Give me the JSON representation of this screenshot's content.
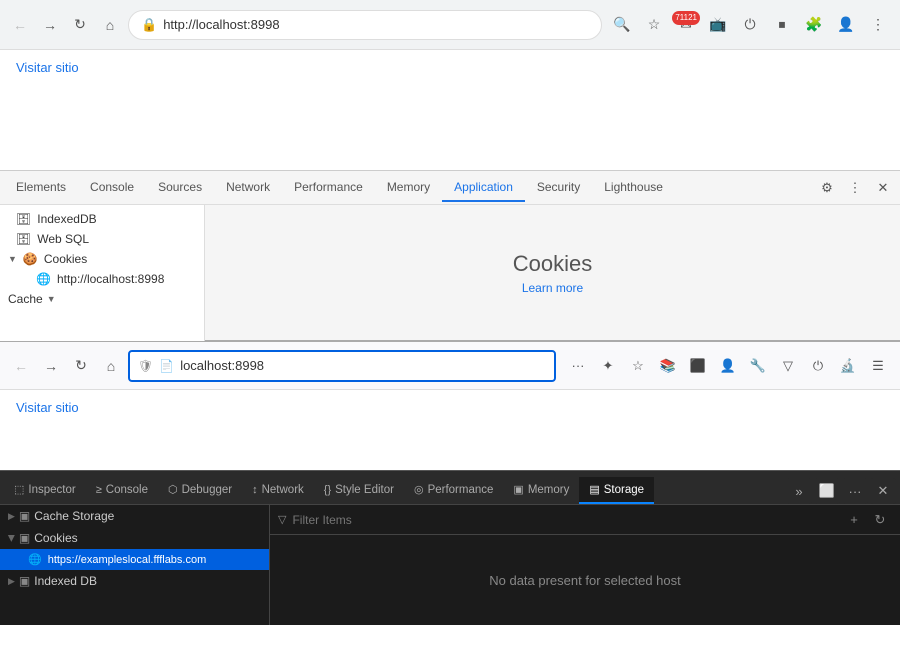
{
  "chrome": {
    "address": "http://localhost:8998",
    "visit_link": "Visitar sitio",
    "nav": {
      "back_label": "←",
      "forward_label": "→",
      "reload_label": "↻",
      "home_label": "⌂"
    },
    "badge_count": "71121",
    "devtools": {
      "tabs": [
        {
          "label": "Elements",
          "active": false
        },
        {
          "label": "Console",
          "active": false
        },
        {
          "label": "Sources",
          "active": false
        },
        {
          "label": "Network",
          "active": false
        },
        {
          "label": "Performance",
          "active": false
        },
        {
          "label": "Memory",
          "active": false
        },
        {
          "label": "Application",
          "active": true
        },
        {
          "label": "Security",
          "active": false
        },
        {
          "label": "Lighthouse",
          "active": false
        }
      ],
      "sidebar_items": [
        {
          "label": "IndexedDB",
          "icon": "🗄",
          "indent": 1
        },
        {
          "label": "Web SQL",
          "icon": "🗄",
          "indent": 1
        },
        {
          "label": "Cookies",
          "icon": "🍪",
          "indent": 0,
          "expanded": true
        },
        {
          "label": "http://localhost:8998",
          "icon": "🌐",
          "indent": 2
        }
      ],
      "cache_label": "Cache",
      "cookies_title": "Cookies",
      "cookies_learn": "Learn more"
    }
  },
  "firefox": {
    "address": "localhost:8998",
    "visit_link": "Visitar sitio",
    "nav": {
      "back_label": "←",
      "forward_label": "→",
      "reload_label": "↻",
      "home_label": "⌂"
    },
    "devtools": {
      "tabs": [
        {
          "label": "Inspector",
          "icon": "⬚",
          "active": false
        },
        {
          "label": "Console",
          "icon": "≥",
          "active": false
        },
        {
          "label": "Debugger",
          "icon": "⬡",
          "active": false
        },
        {
          "label": "Network",
          "icon": "↕",
          "active": false
        },
        {
          "label": "Style Editor",
          "icon": "{}",
          "active": false
        },
        {
          "label": "Performance",
          "icon": "◎",
          "active": false
        },
        {
          "label": "Memory",
          "icon": "▣",
          "active": false
        },
        {
          "label": "Storage",
          "icon": "▤",
          "active": true
        }
      ],
      "sidebar_items": [
        {
          "label": "Cache Storage",
          "icon": "▣",
          "expanded": false
        },
        {
          "label": "Cookies",
          "icon": "▣",
          "expanded": true
        },
        {
          "label": "https://exampleslocal.ffflabs.com",
          "icon": "🌐",
          "selected": true
        },
        {
          "label": "Indexed DB",
          "icon": "▣",
          "expanded": false
        }
      ],
      "filter_placeholder": "Filter Items",
      "no_data_text": "No data present for selected host"
    }
  }
}
